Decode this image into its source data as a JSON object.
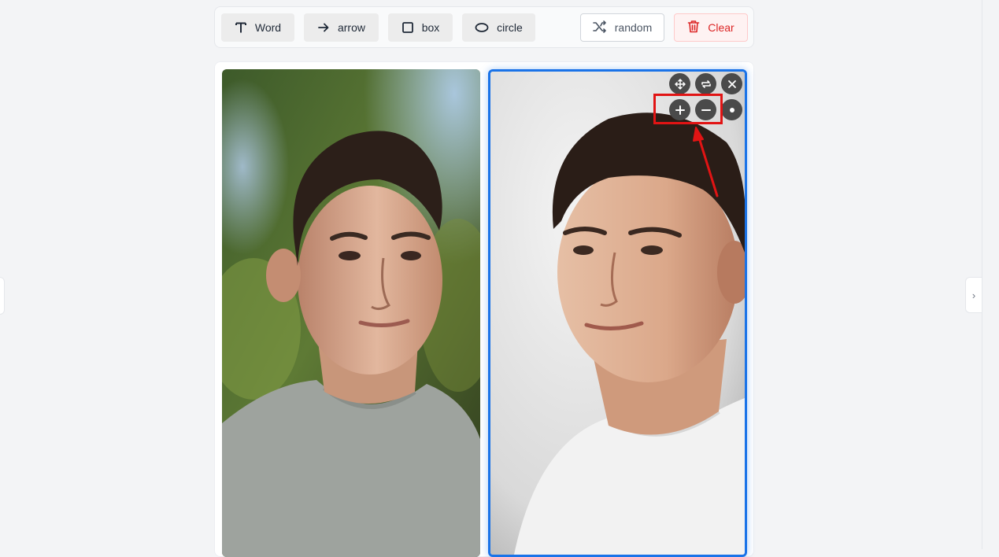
{
  "toolbar": {
    "tools": [
      {
        "label": "Word",
        "icon": "text-icon"
      },
      {
        "label": "arrow",
        "icon": "arrow-right-icon"
      },
      {
        "label": "box",
        "icon": "square-icon"
      },
      {
        "label": "circle",
        "icon": "ellipse-icon"
      }
    ],
    "random_label": "random",
    "clear_label": "Clear"
  },
  "right_handle_glyph": "›",
  "image_controls": {
    "row1": [
      "move-icon",
      "swap-icon",
      "close-icon"
    ],
    "row2": [
      "zoom-in-icon",
      "zoom-out-icon",
      "dot-icon"
    ]
  },
  "colors": {
    "selection_border": "#1a73e8",
    "annotation_red": "#e11414",
    "clear_text": "#dc2626"
  }
}
